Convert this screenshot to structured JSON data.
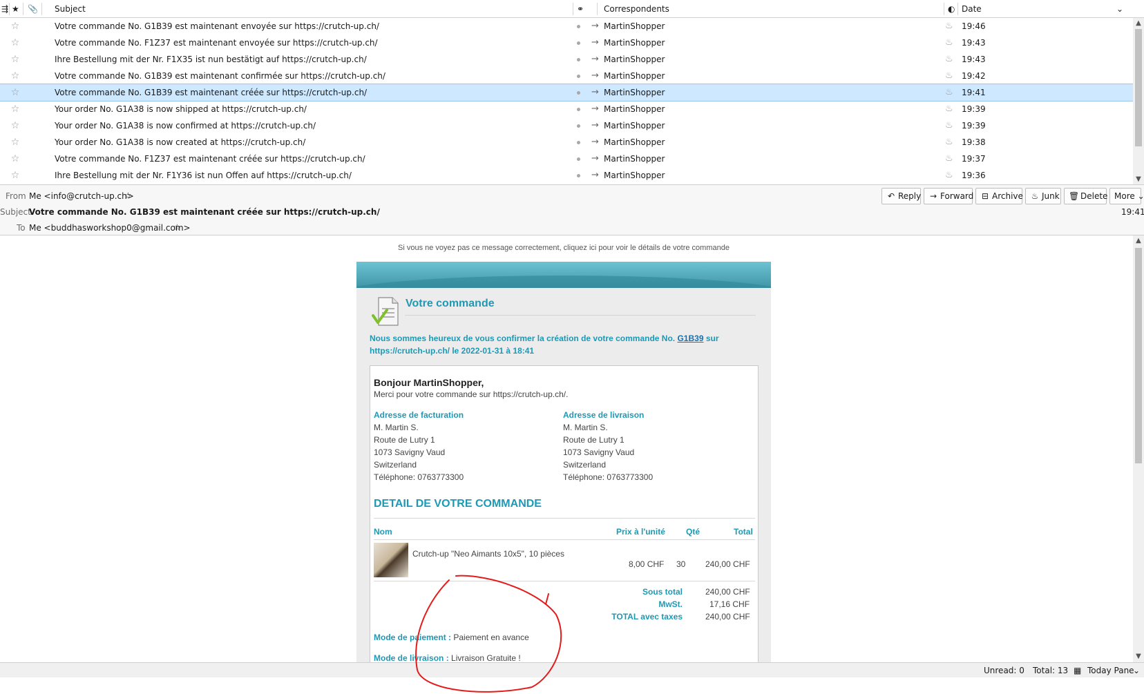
{
  "list": {
    "columns": {
      "subject": "Subject",
      "correspondents": "Correspondents",
      "date": "Date"
    },
    "rows": [
      {
        "subject": "Votre commande No. G1B39 est maintenant envoyée sur https://crutch-up.ch/",
        "correspondent": "MartinShopper",
        "date": "19:46"
      },
      {
        "subject": "Votre commande No. F1Z37 est maintenant envoyée sur https://crutch-up.ch/",
        "correspondent": "MartinShopper",
        "date": "19:43"
      },
      {
        "subject": "Ihre Bestellung mit der Nr. F1X35 ist nun bestätigt auf https://crutch-up.ch/",
        "correspondent": "MartinShopper",
        "date": "19:43"
      },
      {
        "subject": "Votre commande No. G1B39 est maintenant confirmée sur https://crutch-up.ch/",
        "correspondent": "MartinShopper",
        "date": "19:42"
      },
      {
        "subject": "Votre commande No. G1B39 est maintenant créée sur https://crutch-up.ch/",
        "correspondent": "MartinShopper",
        "date": "19:41",
        "selected": true
      },
      {
        "subject": "Your order No. G1A38 is now shipped at https://crutch-up.ch/",
        "correspondent": "MartinShopper",
        "date": "19:39"
      },
      {
        "subject": "Your order No. G1A38 is now confirmed at https://crutch-up.ch/",
        "correspondent": "MartinShopper",
        "date": "19:39"
      },
      {
        "subject": "Your order No. G1A38 is now created at https://crutch-up.ch/",
        "correspondent": "MartinShopper",
        "date": "19:38"
      },
      {
        "subject": "Votre commande No. F1Z37 est maintenant créée sur https://crutch-up.ch/",
        "correspondent": "MartinShopper",
        "date": "19:37"
      },
      {
        "subject": "Ihre Bestellung mit der Nr. F1Y36 ist nun Offen auf https://crutch-up.ch/",
        "correspondent": "MartinShopper",
        "date": "19:36"
      }
    ]
  },
  "header": {
    "from_label": "From",
    "from_value": "Me <info@crutch-up.ch>",
    "subject_label": "Subject",
    "subject_value": "Votre commande No. G1B39 est maintenant créée sur https://crutch-up.ch/",
    "to_label": "To",
    "to_value": "Me <buddhasworkshop0@gmail.com>",
    "time": "19:41",
    "buttons": {
      "reply": "Reply",
      "forward": "Forward",
      "archive": "Archive",
      "junk": "Junk",
      "delete": "Delete",
      "more": "More"
    }
  },
  "email": {
    "notice": "Si vous ne voyez pas ce message correctement, cliquez ici pour voir le détails de votre commande",
    "title": "Votre commande",
    "intro_before": "Nous sommes heureux de vous confirmer la création de votre commande No. ",
    "order_no": "G1B39",
    "intro_after": " sur https://crutch-up.ch/ le 2022-01-31 à 18:41",
    "greeting": "Bonjour MartinShopper,",
    "thanks": "Merci pour votre commande sur https://crutch-up.ch/.",
    "billing": {
      "heading": "Adresse de facturation",
      "name": "M. Martin S.",
      "street": "Route de Lutry 1",
      "city": "1073 Savigny Vaud",
      "country": "Switzerland",
      "phone": "Téléphone: 0763773300"
    },
    "shipping": {
      "heading": "Adresse de livraison",
      "name": "M. Martin S.",
      "street": "Route de Lutry 1",
      "city": "1073 Savigny Vaud",
      "country": "Switzerland",
      "phone": "Téléphone: 0763773300"
    },
    "detail_title": "DETAIL DE VOTRE COMMANDE",
    "table_headers": {
      "name": "Nom",
      "unit_price": "Prix à l'unité",
      "qty": "Qté",
      "total": "Total"
    },
    "item": {
      "name": "Crutch-up \"Neo Aimants 10x5\", 10 pièces",
      "unit_price": "8,00 CHF",
      "qty": "30",
      "total": "240,00 CHF"
    },
    "totals": {
      "subtotal_label": "Sous total",
      "subtotal": "240,00 CHF",
      "tax_label": "MwSt.",
      "tax": "17,16 CHF",
      "total_label": "TOTAL avec taxes",
      "total": "240,00 CHF"
    },
    "payment_label": "Mode de paiement :",
    "payment_value": " Paiement en avance",
    "delivery_label": "Mode de livraison :",
    "delivery_value": " Livraison Gratuite !"
  },
  "status": {
    "unread": "Unread: 0",
    "total": "Total: 13",
    "today_pane": "Today Pane"
  },
  "colors": {
    "accent": "#1f98b4",
    "selection": "#cde8ff",
    "annotation": "#e41b1b"
  }
}
